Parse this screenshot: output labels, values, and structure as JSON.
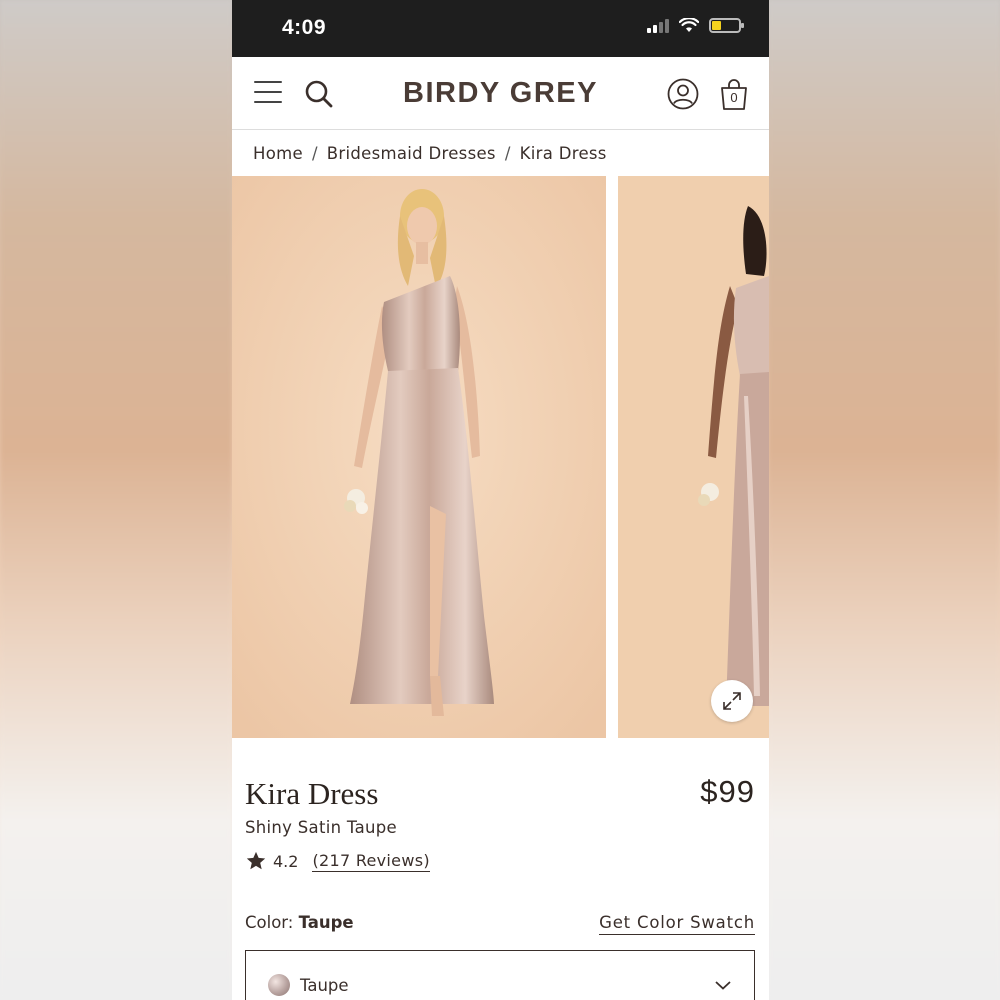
{
  "status_bar": {
    "time": "4:09"
  },
  "nav": {
    "brand": "BIRDY GREY"
  },
  "cart": {
    "count": "0"
  },
  "breadcrumb": {
    "items": [
      "Home",
      "Bridesmaid Dresses",
      "Kira Dress"
    ],
    "separator": "/"
  },
  "product": {
    "title": "Kira Dress",
    "price": "$99",
    "subtitle": "Shiny Satin Taupe",
    "rating": "4.2",
    "reviews": "(217 Reviews)"
  },
  "color": {
    "label": "Color:",
    "selected": "Taupe",
    "swatch_link": "Get Color Swatch",
    "dropdown_value": "Taupe"
  },
  "icons": [
    "menu-icon",
    "search-icon",
    "account-icon",
    "bag-icon",
    "expand-icon",
    "star-icon",
    "chevron-down-icon"
  ],
  "colors": {
    "brand_text": "#4a3c36",
    "status_bar": "#1e1e1e",
    "battery": "#f4d21e",
    "photo_bg": "#f0d0b1"
  }
}
